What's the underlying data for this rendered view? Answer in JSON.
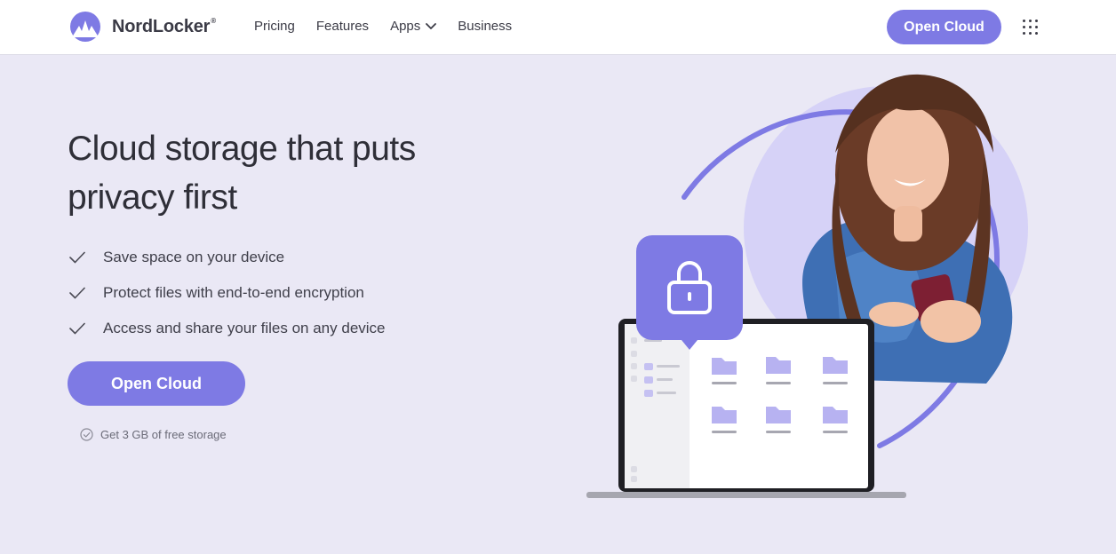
{
  "brand": {
    "name": "NordLocker",
    "mark": "®",
    "logo_icon": "nordlocker-logo-icon"
  },
  "nav": {
    "items": [
      "Pricing",
      "Features",
      "Apps",
      "Business"
    ],
    "apps_chevron_icon": "chevron-down-icon"
  },
  "header_cta": {
    "label": "Open Cloud"
  },
  "grid_menu_icon": "apps-grid-icon",
  "hero": {
    "title": "Cloud storage that puts privacy first",
    "features": [
      "Save space on your device",
      "Protect files with end-to-end encryption",
      "Access and share your files on any device"
    ],
    "feature_icon": "check-icon",
    "cta_label": "Open Cloud",
    "free_note": "Get 3 GB of free storage",
    "free_note_icon": "check-circle-icon"
  },
  "illustration": {
    "lock_icon": "padlock-icon",
    "folder_icon": "folder-icon",
    "device": "laptop",
    "person": "woman-with-phone"
  },
  "colors": {
    "accent": "#7e7ae4",
    "background": "#eae8f5",
    "circle": "#d6d2f7",
    "text": "#2f2f38"
  }
}
